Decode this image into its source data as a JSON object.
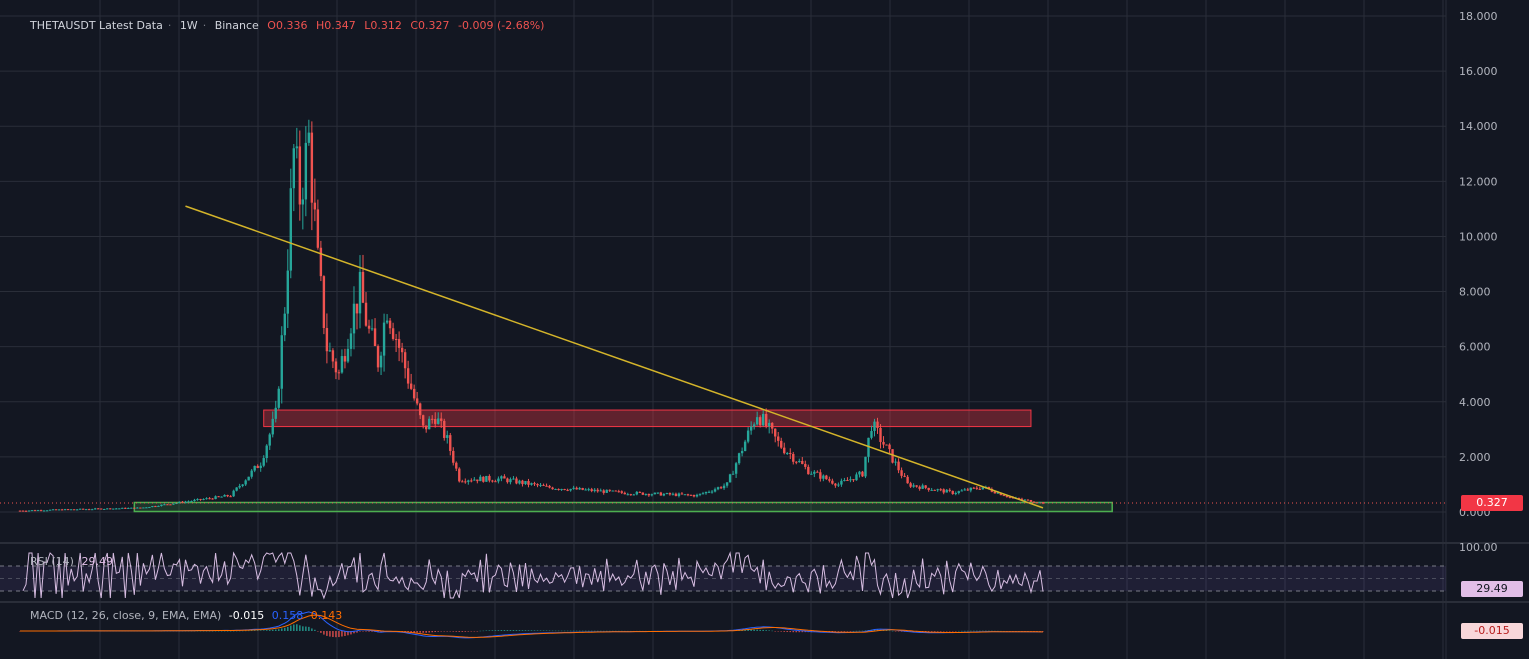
{
  "header": {
    "symbol": "THETAUSDT Latest Data",
    "interval": "1W",
    "exchange": "Binance",
    "open": "O0.336",
    "high": "H0.347",
    "low": "L0.312",
    "close": "C0.327",
    "change": "-0.009 (-2.68%)"
  },
  "colors": {
    "background": "#131722",
    "grid": "#2a2e39",
    "up": "#26a69a",
    "down": "#ef5350",
    "trendline": "#d4b42a",
    "support_box": "#4caf50",
    "resistance_box": "#f23645",
    "rsi": "#d7bde2",
    "macd": "#2962ff",
    "signal": "#ff6d00"
  },
  "price_axis": {
    "ticks": [
      "18.000",
      "16.000",
      "14.000",
      "12.000",
      "10.000",
      "8.000",
      "6.000",
      "4.000",
      "2.000",
      "0.000"
    ],
    "last_price": "0.327"
  },
  "rsi": {
    "label": "RSI (14)",
    "value": "29.49",
    "axis_top": "100.00"
  },
  "macd": {
    "label": "MACD (12, 26, close, 9, EMA, EMA)",
    "macd_value": "-0.015",
    "signal_value": "0.158",
    "hist_value": "0.143",
    "badge": "-0.015"
  },
  "chart_data": {
    "type": "candlestick",
    "ylim": [
      0,
      18
    ],
    "x_index_range": [
      0,
      340
    ],
    "key_points": [
      {
        "i": 0,
        "price": 0.05
      },
      {
        "i": 40,
        "price": 0.15
      },
      {
        "i": 70,
        "price": 0.6
      },
      {
        "i": 80,
        "price": 1.8
      },
      {
        "i": 85,
        "price": 3.5
      },
      {
        "i": 88,
        "price": 7.5
      },
      {
        "i": 91,
        "price": 13.0
      },
      {
        "i": 93,
        "price": 11.5
      },
      {
        "i": 96,
        "price": 13.5
      },
      {
        "i": 99,
        "price": 9.0
      },
      {
        "i": 102,
        "price": 6.0
      },
      {
        "i": 106,
        "price": 5.0
      },
      {
        "i": 110,
        "price": 7.0
      },
      {
        "i": 113,
        "price": 8.0
      },
      {
        "i": 116,
        "price": 6.5
      },
      {
        "i": 119,
        "price": 5.5
      },
      {
        "i": 122,
        "price": 7.5
      },
      {
        "i": 126,
        "price": 6.0
      },
      {
        "i": 130,
        "price": 4.5
      },
      {
        "i": 134,
        "price": 3.0
      },
      {
        "i": 138,
        "price": 3.5
      },
      {
        "i": 142,
        "price": 2.6
      },
      {
        "i": 146,
        "price": 1.2
      },
      {
        "i": 160,
        "price": 1.2
      },
      {
        "i": 175,
        "price": 0.9
      },
      {
        "i": 200,
        "price": 0.7
      },
      {
        "i": 225,
        "price": 0.6
      },
      {
        "i": 235,
        "price": 1.0
      },
      {
        "i": 245,
        "price": 3.6
      },
      {
        "i": 252,
        "price": 2.5
      },
      {
        "i": 262,
        "price": 1.5
      },
      {
        "i": 272,
        "price": 1.0
      },
      {
        "i": 280,
        "price": 1.4
      },
      {
        "i": 283,
        "price": 3.2
      },
      {
        "i": 288,
        "price": 2.3
      },
      {
        "i": 295,
        "price": 1.0
      },
      {
        "i": 310,
        "price": 0.7
      },
      {
        "i": 320,
        "price": 0.9
      },
      {
        "i": 330,
        "price": 0.5
      },
      {
        "i": 340,
        "price": 0.33
      }
    ],
    "annotations": {
      "trendline": {
        "from": {
          "i": 55,
          "price": 11.1
        },
        "to": {
          "i": 340,
          "price": 0.15
        }
      },
      "resistance_zone": {
        "i_start": 81,
        "i_end": 336,
        "price_low": 3.1,
        "price_high": 3.7
      },
      "support_zone": {
        "i_start": 38,
        "i_end": 363,
        "price_low": 0.0,
        "price_high": 0.2
      }
    }
  }
}
